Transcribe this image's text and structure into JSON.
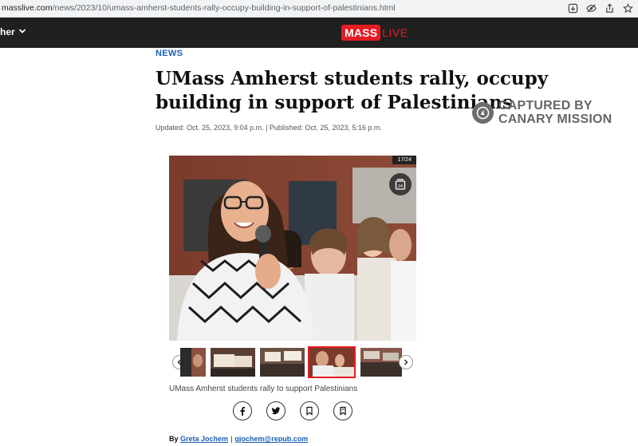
{
  "browser": {
    "url_host": "masslive.com",
    "url_path": "/news/2023/10/umass-amherst-students-rally-occupy-building-in-support-of-palestinians.html",
    "icons": [
      "download-icon",
      "eye-off-icon",
      "share-icon",
      "star-icon"
    ]
  },
  "header": {
    "nav_more_label": "her",
    "logo_mass": "MASS",
    "logo_live": "LIVE",
    "brand_color": "#e51c23",
    "bar_color": "#202020"
  },
  "article": {
    "kicker": "NEWS",
    "headline": "UMass Amherst students rally, occupy building in support of Palestinians",
    "dates": "Updated: Oct. 25, 2023, 9:04 p.m. | Published: Oct. 25, 2023, 5:16 p.m.",
    "kicker_color": "#1a5fb4"
  },
  "watermark": {
    "line1": "CAPTURED BY",
    "line2": "CANARY MISSION"
  },
  "gallery": {
    "counter": "17/24",
    "gallery_count": "24",
    "caption": "UMass Amherst students rally to support Palestinians",
    "active_thumb": 3
  },
  "share": {
    "buttons": [
      "facebook-icon",
      "twitter-icon",
      "bookmark-icon",
      "save-icon"
    ]
  },
  "byline": {
    "prefix": "By",
    "author": "Greta Jochem",
    "email": "gjochem@repub.com"
  }
}
